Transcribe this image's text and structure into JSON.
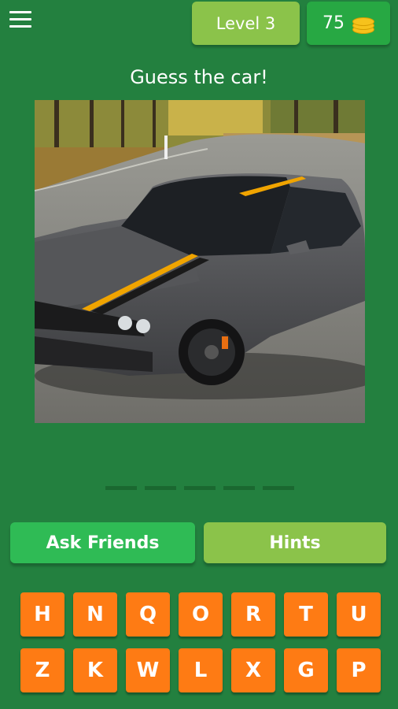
{
  "header": {
    "menu_icon": "hamburger-menu-icon",
    "level_label": "Level 3",
    "coins": "75",
    "coins_icon": "coin-stack-icon"
  },
  "prompt": "Guess the car!",
  "answer_slots": 5,
  "actions": {
    "ask_friends": "Ask Friends",
    "hints": "Hints"
  },
  "keyboard": {
    "row1": [
      "H",
      "N",
      "Q",
      "O",
      "R",
      "T",
      "U"
    ],
    "row2": [
      "Z",
      "K",
      "W",
      "L",
      "X",
      "G",
      "P"
    ]
  },
  "colors": {
    "background": "#23803f",
    "level_button": "#8bc34a",
    "coins_button": "#27a843",
    "ask_friends_button": "#2fbb55",
    "hints_button": "#8bc34a",
    "key": "#fe7b14"
  }
}
